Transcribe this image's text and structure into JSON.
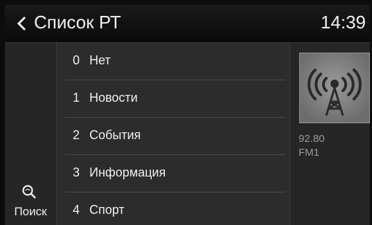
{
  "header": {
    "title": "Список РТ",
    "time": "14:39",
    "back_icon": "chevron-left-icon"
  },
  "sidebar": {
    "search_label": "Поиск",
    "search_icon": "search-icon"
  },
  "pty_list": [
    {
      "num": "0",
      "name": "Нет"
    },
    {
      "num": "1",
      "name": "Новости"
    },
    {
      "num": "2",
      "name": "События"
    },
    {
      "num": "3",
      "name": "Информация"
    },
    {
      "num": "4",
      "name": "Спорт"
    }
  ],
  "station": {
    "frequency": "92.80",
    "band": "FM1",
    "art_icon": "radio-tower-icon"
  }
}
